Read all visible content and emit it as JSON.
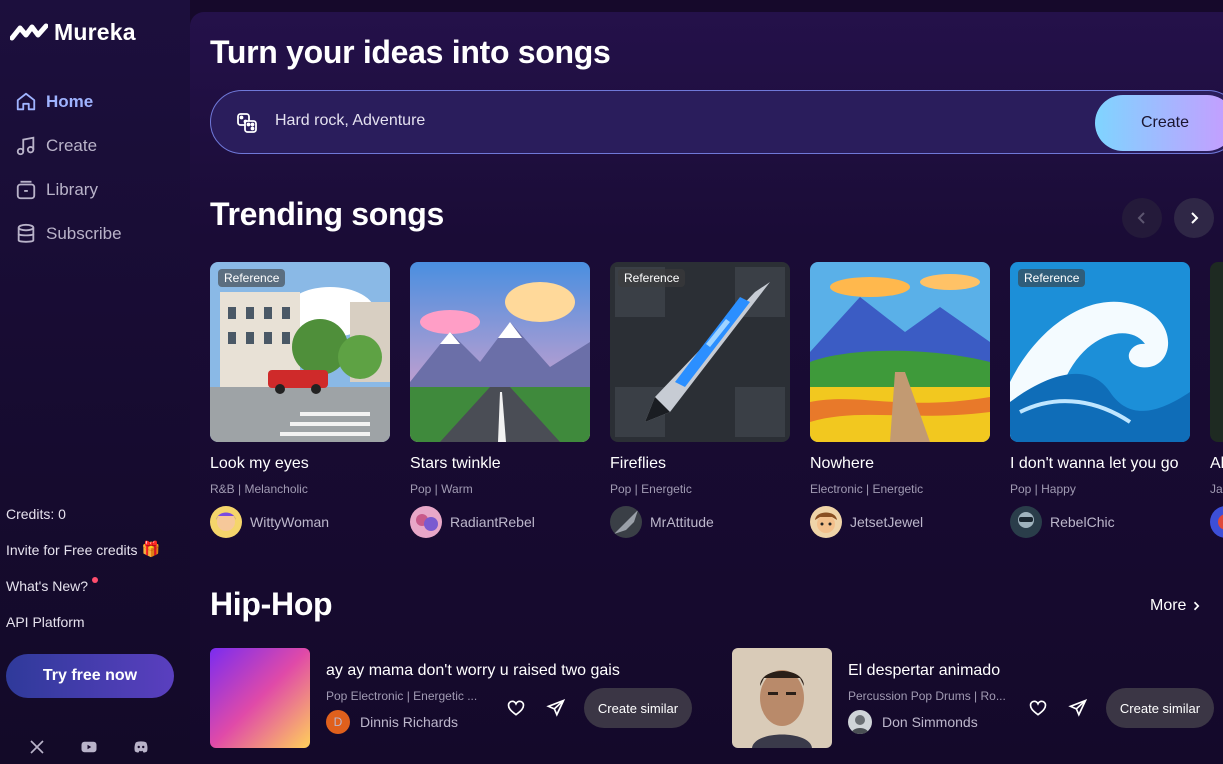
{
  "app": {
    "name": "Mureka"
  },
  "sidebar": {
    "nav": [
      {
        "label": "Home",
        "icon": "home-icon",
        "active": true
      },
      {
        "label": "Create",
        "icon": "music-note-icon",
        "active": false
      },
      {
        "label": "Library",
        "icon": "library-icon",
        "active": false
      },
      {
        "label": "Subscribe",
        "icon": "database-icon",
        "active": false
      }
    ],
    "credits": "Credits: 0",
    "invite": "Invite for Free credits",
    "whats_new": "What's New?",
    "api": "API Platform",
    "try_button": "Try free now",
    "socials": [
      "x-icon",
      "youtube-icon",
      "discord-icon"
    ]
  },
  "hero": {
    "headline": "Turn your ideas into songs",
    "prompt_value": "Hard rock, Adventure",
    "create_label": "Create"
  },
  "trending": {
    "title": "Trending songs",
    "reference_label": "Reference",
    "songs": [
      {
        "title": "Look my eyes",
        "tags": "R&B | Melancholic",
        "author": "WittyWoman",
        "reference": true
      },
      {
        "title": "Stars twinkle",
        "tags": "Pop | Warm",
        "author": "RadiantRebel",
        "reference": false
      },
      {
        "title": "Fireflies",
        "tags": "Pop | Energetic",
        "author": "MrAttitude",
        "reference": true
      },
      {
        "title": "Nowhere",
        "tags": "Electronic | Energetic",
        "author": "JetsetJewel",
        "reference": false
      },
      {
        "title": "I don't wanna let you go",
        "tags": "Pop | Happy",
        "author": "RebelChic",
        "reference": true
      },
      {
        "title": "Al",
        "tags": "Ja",
        "author": "",
        "reference": false
      }
    ]
  },
  "hiphop": {
    "title": "Hip-Hop",
    "more_label": "More",
    "similar_label": "Create similar",
    "tracks": [
      {
        "title": "ay ay mama don't worry u raised two gais",
        "tags": "Pop Electronic | Energetic ...",
        "author": "Dinnis Richards",
        "initial": "D"
      },
      {
        "title": "El despertar animado",
        "tags": "Percussion Pop Drums | Ro...",
        "author": "Don Simmonds",
        "initial": ""
      }
    ]
  },
  "colors": {
    "accent": "#9fb3ff",
    "background": "#16092b",
    "create_gradient": [
      "#7fd4ff",
      "#c89bff"
    ]
  }
}
